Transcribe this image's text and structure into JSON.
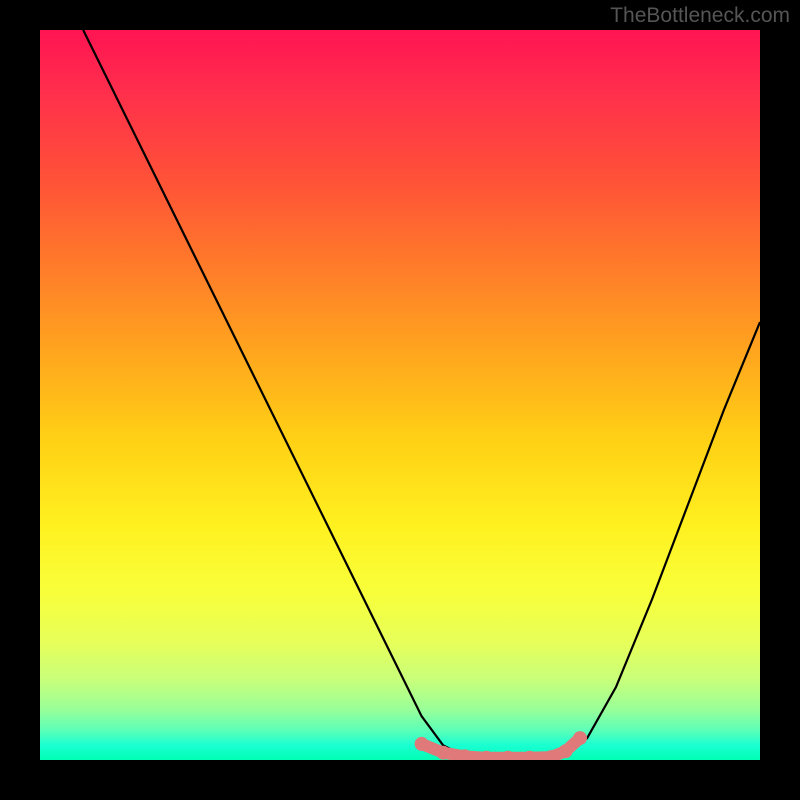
{
  "watermark": "TheBottleneck.com",
  "chart_data": {
    "type": "line",
    "title": "",
    "xlabel": "",
    "ylabel": "",
    "xlim": [
      0,
      100
    ],
    "ylim": [
      0,
      100
    ],
    "series": [
      {
        "name": "curve",
        "x": [
          6,
          10,
          15,
          20,
          25,
          30,
          35,
          40,
          45,
          50,
          53,
          56,
          60,
          65,
          70,
          73,
          76,
          80,
          85,
          90,
          95,
          100
        ],
        "values": [
          100,
          92,
          82,
          72,
          62,
          52,
          42,
          32,
          22,
          12,
          6,
          2,
          0,
          0,
          0,
          0.5,
          3,
          10,
          22,
          35,
          48,
          60
        ]
      }
    ],
    "highlight": {
      "name": "bottom-markers",
      "x": [
        53,
        56,
        59,
        62,
        65,
        68,
        71,
        73,
        75
      ],
      "values": [
        2.2,
        1.0,
        0.5,
        0.3,
        0.3,
        0.3,
        0.4,
        1.2,
        3.0
      ],
      "color": "#e07a7a"
    }
  }
}
